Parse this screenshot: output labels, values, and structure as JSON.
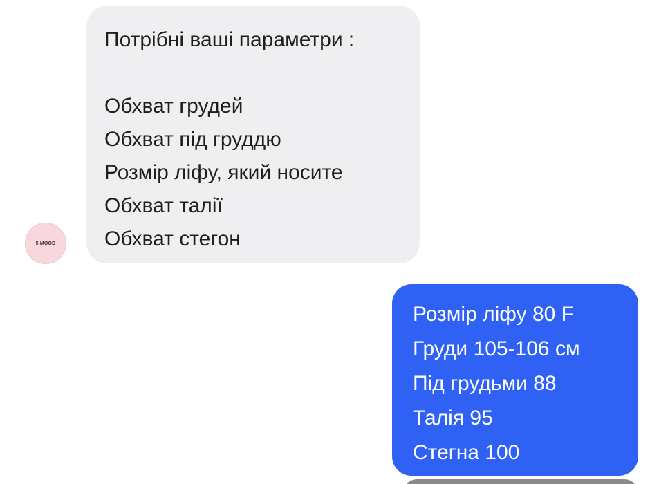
{
  "incoming": {
    "lines": [
      "Потрібні ваші параметри :",
      "",
      "Обхват грудей",
      "Обхват під груддю",
      "Розмір ліфу, який носите",
      "Обхват талії",
      "Обхват стегон"
    ],
    "avatar_text": "5 MOOD"
  },
  "outgoing": {
    "lines": [
      "Розмір ліфу 80 F",
      "Груди 105-106 см",
      "Під грудьми 88",
      "Талія 95",
      "Стегна 100"
    ]
  },
  "colors": {
    "incoming_bubble": "#efeff1",
    "outgoing_bubble": "#2f62f4",
    "avatar_bg": "#f9d8dd"
  }
}
